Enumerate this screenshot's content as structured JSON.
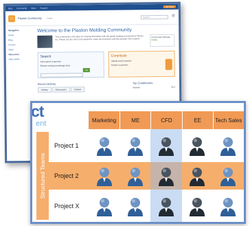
{
  "portal": {
    "topbar": {
      "links": [
        "Blog",
        "Community",
        "Ideas",
        "Support"
      ],
      "cta": "Join Now"
    },
    "header": {
      "site": "Plaston Community",
      "breadcrumb": "› Home",
      "search_placeholder": "Search..."
    },
    "sidebar": {
      "items": [
        {
          "label": "Navigation",
          "heading": true
        },
        {
          "label": "Home",
          "heading": false
        },
        {
          "label": "Blog",
          "heading": false
        },
        {
          "label": "Forums",
          "heading": false
        },
        {
          "label": "Ideas",
          "heading": false
        },
        {
          "label": "Resources",
          "heading": true
        },
        {
          "label": "Help Center",
          "heading": false
        }
      ]
    },
    "title": "Welcome to the Plaston Molding Community",
    "intro": "This community is the place for sharing information with the global molding community at Plaston Inc. Please use the site to ask questions, share best practices and find answers from experts.",
    "profile": {
      "label": "Community Manager",
      "status": "Online"
    },
    "search_panel": {
      "title": "Search",
      "items": [
        "Ask experts a question",
        "Browse existing knowledge base"
      ],
      "go": "Go"
    },
    "contribute_panel": {
      "title": "Contribute",
      "items": [
        "Upload a best practice",
        "Answer a question"
      ]
    },
    "recent": {
      "label": "Recent Activity",
      "tabs": [
        "Activity",
        "Discussions",
        "Content"
      ]
    },
    "contributors": {
      "label": "Top Contributors",
      "rows": [
        {
          "name": "member",
          "points": "25.2"
        }
      ]
    }
  },
  "matrix": {
    "brand": "ct",
    "brand_sub": "ent",
    "sidebar_label": "Structured Teams",
    "columns": [
      "Marketing",
      "ME",
      "CFD",
      "EE",
      "Tech Sales"
    ],
    "rows": [
      {
        "label": "Project 1",
        "avatars": [
          "blue-suit",
          "blue-suit",
          "dark-suit",
          "dark-suit",
          "blue-suit"
        ]
      },
      {
        "label": "Project 2",
        "avatars": [
          "blue-suit",
          "blue-suit",
          "dark-suit",
          "dark-suit",
          "blue-suit"
        ]
      },
      {
        "label": "Project X",
        "avatars": [
          "blue-suit",
          "blue-suit",
          "dark-suit",
          "dark-suit",
          "blue-suit"
        ]
      }
    ],
    "highlight_row": 1,
    "highlight_column": 2,
    "colors": {
      "header": "#f19a55",
      "row_highlight": "#f6ae6c",
      "column_highlight": "#a9c6ef",
      "frame": "#6b8fc7",
      "avatar_blue": "#2f5f98",
      "avatar_dark": "#222a33"
    }
  }
}
